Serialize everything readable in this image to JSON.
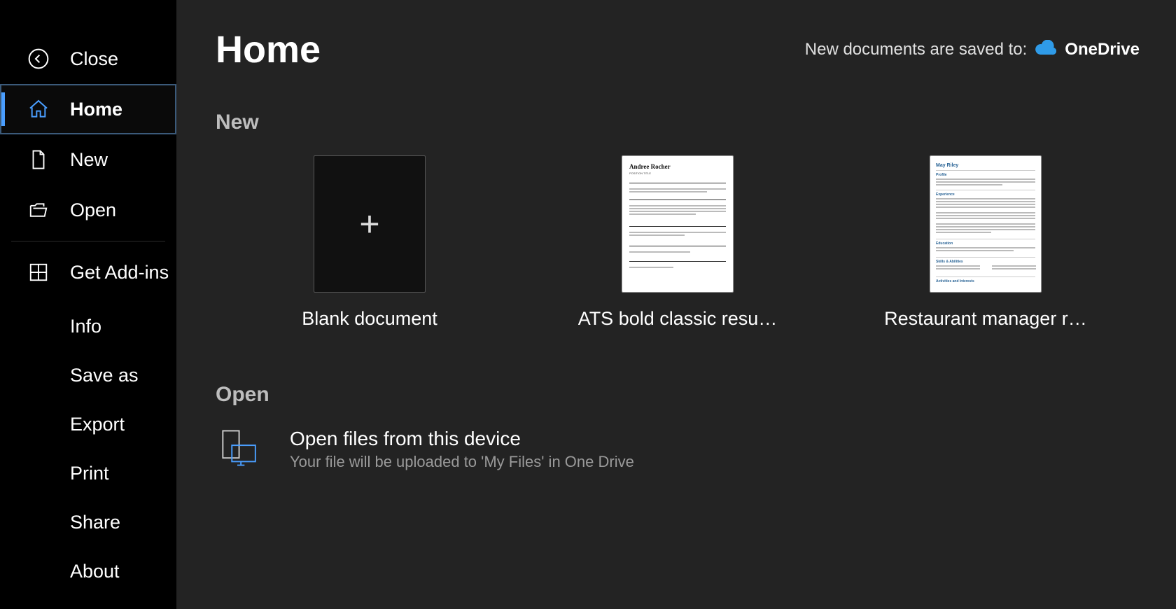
{
  "sidebar": {
    "close": "Close",
    "home": "Home",
    "new": "New",
    "open": "Open",
    "addins": "Get Add-ins",
    "sub": {
      "info": "Info",
      "saveas": "Save as",
      "export": "Export",
      "print": "Print",
      "share": "Share",
      "about": "About"
    }
  },
  "main": {
    "title": "Home",
    "save_dest_label": "New documents are saved to:",
    "save_dest_target": "OneDrive",
    "section_new": "New",
    "templates": {
      "blank": "Blank document",
      "ats": "ATS bold classic resu…",
      "rest": "Restaurant manager r…",
      "thumb_ats_name": "Andree Rocher",
      "thumb_rest_name": "May Riley"
    },
    "section_open": "Open",
    "open_device_title": "Open files from this device",
    "open_device_sub": "Your file will be uploaded to 'My Files' in One Drive"
  }
}
